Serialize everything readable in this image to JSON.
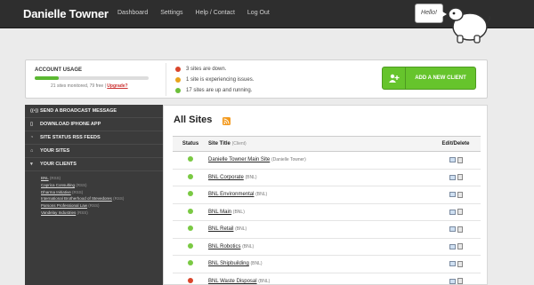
{
  "header": {
    "brand": "Danielle Towner",
    "nav": [
      "Dashboard",
      "Settings",
      "Help / Contact",
      "Log Out"
    ],
    "greeting": "Hello!"
  },
  "usage": {
    "title": "ACCOUNT USAGE",
    "progress_fraction": 0.21,
    "note": "21 sites monitored, 79 free |",
    "upgrade": "Upgrade?"
  },
  "status": [
    {
      "color": "red",
      "text": "3 sites are down."
    },
    {
      "color": "orange",
      "text": "1 site is experiencing issues."
    },
    {
      "color": "green",
      "text": "17 sites are up and running."
    }
  ],
  "add_client": {
    "label": "ADD A NEW CLIENT",
    "icon": "add-user-icon"
  },
  "sidebar": {
    "items": [
      {
        "icon": "broadcast-icon",
        "glyph": "((•))",
        "label": "SEND A BROADCAST MESSAGE"
      },
      {
        "icon": "phone-icon",
        "glyph": "▯",
        "label": "DOWNLOAD IPHONE APP"
      },
      {
        "icon": "rss-icon",
        "glyph": "◔",
        "label": "SITE STATUS RSS FEEDS"
      },
      {
        "icon": "home-icon",
        "glyph": "⌂",
        "label": "YOUR SITES"
      },
      {
        "icon": "triangle-down-icon",
        "glyph": "▾",
        "label": "YOUR CLIENTS"
      }
    ],
    "clients": [
      {
        "name": "BNL",
        "rss": "(RSS)"
      },
      {
        "name": "Caprica Consulting",
        "rss": "(RSS)"
      },
      {
        "name": "Dharma Initiative",
        "rss": "(RSS)"
      },
      {
        "name": "International Brotherhood of Stevedores",
        "rss": "(RSS)"
      },
      {
        "name": "Parsons Professional Law",
        "rss": "(RSS)"
      },
      {
        "name": "Vandelay Industries",
        "rss": "(RSS)"
      }
    ]
  },
  "main": {
    "title": "All Sites",
    "columns": {
      "status": "Status",
      "site": "Site Title",
      "site_sub": "(Client)",
      "edit": "Edit/Delete"
    },
    "rows": [
      {
        "status": "up",
        "site": "Danielle Towner Main Site",
        "client": "(Danielle Towner)"
      },
      {
        "status": "up",
        "site": "BNL Corporate",
        "client": "(BNL)"
      },
      {
        "status": "up",
        "site": "BNL Environmental",
        "client": "(BNL)"
      },
      {
        "status": "up",
        "site": "BNL Main",
        "client": "(BNL)"
      },
      {
        "status": "up",
        "site": "BNL Retail",
        "client": "(BNL)"
      },
      {
        "status": "up",
        "site": "BNL Robotics",
        "client": "(BNL)"
      },
      {
        "status": "up",
        "site": "BNL Shipbuilding",
        "client": "(BNL)"
      },
      {
        "status": "down",
        "site": "BNL Waste Disposal",
        "client": "(BNL)"
      }
    ]
  },
  "colors": {
    "accent_green": "#66c42c",
    "header_bg": "#2e2e2e",
    "sidebar_bg": "#3b3b3b"
  }
}
